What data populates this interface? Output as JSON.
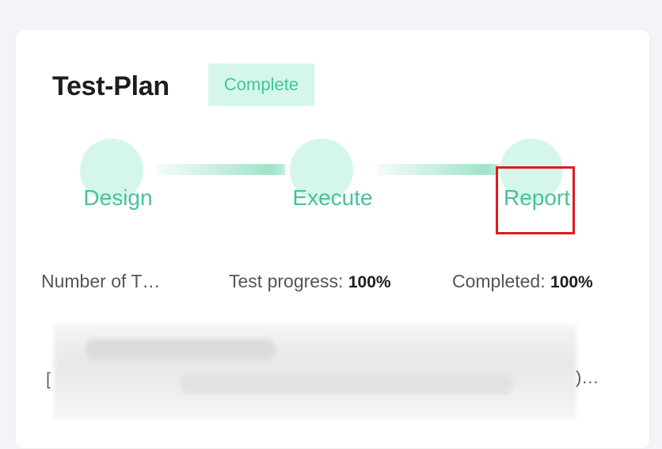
{
  "plan": {
    "title": "Test-Plan",
    "status": "Complete",
    "status_color": "#3fc79a"
  },
  "pipeline": {
    "stages": [
      {
        "label": "Design"
      },
      {
        "label": "Execute"
      },
      {
        "label": "Report"
      }
    ]
  },
  "stats": {
    "cases_label": "Number of T…",
    "progress_label": "Test progress:",
    "progress_value": "100%",
    "completed_label": "Completed:",
    "completed_value": "100%"
  },
  "details": {
    "edge_mark": "[",
    "tail_text": ")…"
  }
}
